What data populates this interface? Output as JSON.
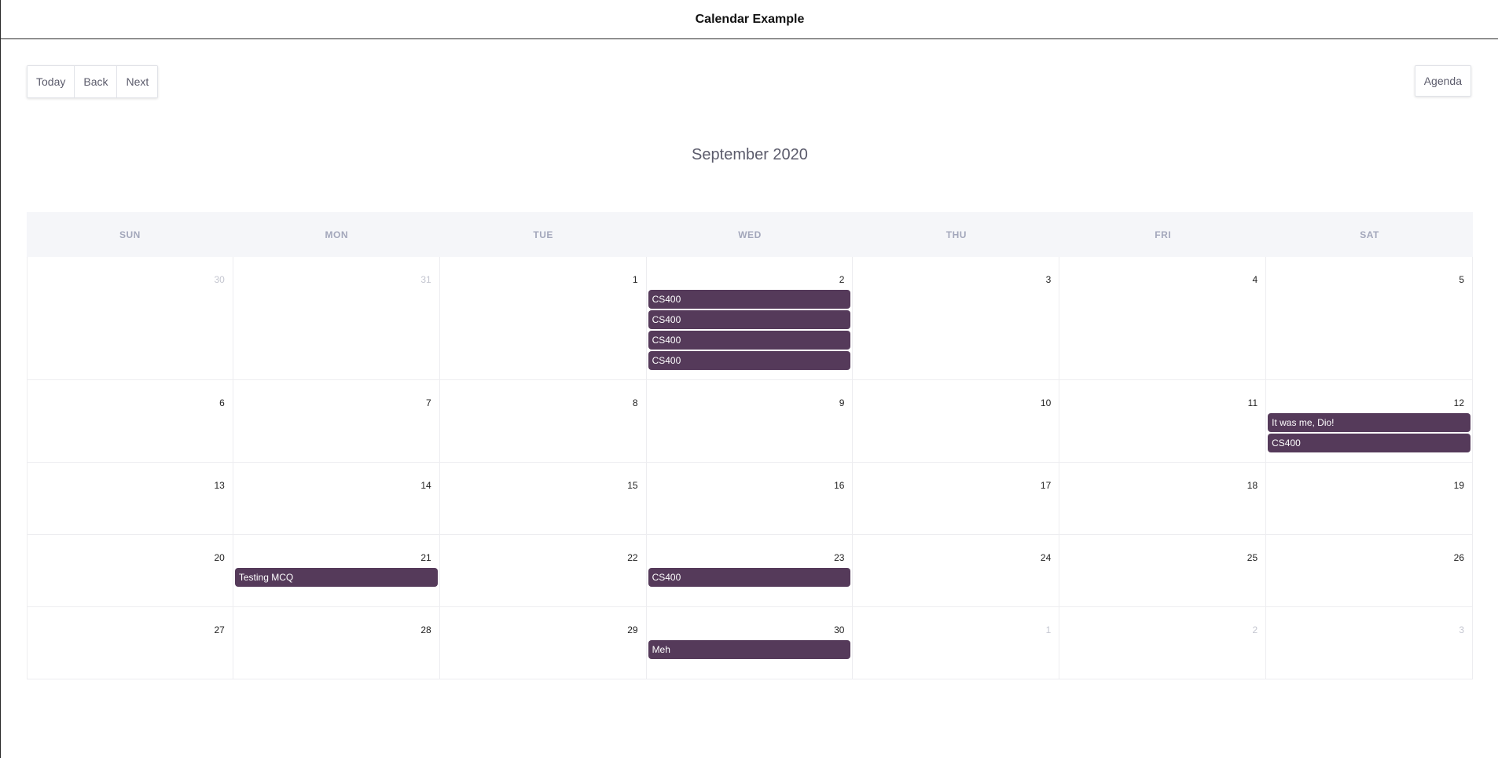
{
  "app": {
    "title": "Calendar Example"
  },
  "toolbar": {
    "today": "Today",
    "back": "Back",
    "next": "Next",
    "view": "Agenda"
  },
  "calendar": {
    "month_label": "September 2020",
    "weekdays": [
      "SUN",
      "MON",
      "TUE",
      "WED",
      "THU",
      "FRI",
      "SAT"
    ],
    "weeks": [
      [
        {
          "num": "30",
          "out": true,
          "events": []
        },
        {
          "num": "31",
          "out": true,
          "events": []
        },
        {
          "num": "1",
          "events": []
        },
        {
          "num": "2",
          "events": [
            "CS400",
            "CS400",
            "CS400",
            "CS400"
          ]
        },
        {
          "num": "3",
          "events": []
        },
        {
          "num": "4",
          "events": []
        },
        {
          "num": "5",
          "events": []
        }
      ],
      [
        {
          "num": "6",
          "events": []
        },
        {
          "num": "7",
          "events": []
        },
        {
          "num": "8",
          "events": []
        },
        {
          "num": "9",
          "events": []
        },
        {
          "num": "10",
          "events": []
        },
        {
          "num": "11",
          "events": []
        },
        {
          "num": "12",
          "events": [
            "It was me, Dio!",
            "CS400"
          ]
        }
      ],
      [
        {
          "num": "13",
          "events": []
        },
        {
          "num": "14",
          "events": []
        },
        {
          "num": "15",
          "events": []
        },
        {
          "num": "16",
          "events": []
        },
        {
          "num": "17",
          "events": []
        },
        {
          "num": "18",
          "events": []
        },
        {
          "num": "19",
          "events": []
        }
      ],
      [
        {
          "num": "20",
          "events": []
        },
        {
          "num": "21",
          "events": [
            "Testing MCQ"
          ]
        },
        {
          "num": "22",
          "events": []
        },
        {
          "num": "23",
          "events": [
            "CS400"
          ]
        },
        {
          "num": "24",
          "events": []
        },
        {
          "num": "25",
          "events": []
        },
        {
          "num": "26",
          "events": []
        }
      ],
      [
        {
          "num": "27",
          "events": []
        },
        {
          "num": "28",
          "events": []
        },
        {
          "num": "29",
          "events": []
        },
        {
          "num": "30",
          "events": [
            "Meh"
          ]
        },
        {
          "num": "1",
          "out": true,
          "events": []
        },
        {
          "num": "2",
          "out": true,
          "events": []
        },
        {
          "num": "3",
          "out": true,
          "events": []
        }
      ]
    ]
  },
  "colors": {
    "event_bg": "#553a5a",
    "event_text": "#ffffff",
    "header_bg": "#f5f6f9",
    "weekday_text": "#a3a7bb"
  }
}
